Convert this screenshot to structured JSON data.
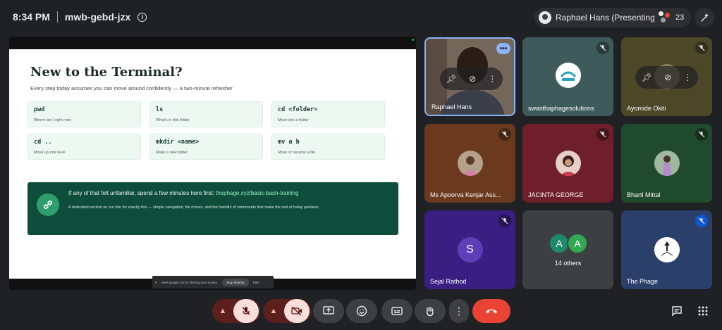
{
  "topbar": {
    "time": "8:34 PM",
    "meeting_code": "mwb-gebd-jzx",
    "presenter_label": "Raphael Hans (Presenting)",
    "people_count": "23"
  },
  "slide": {
    "title": "New to the Terminal?",
    "subtitle": "Every step today assumes you can move around confidently — a two-minute refresher",
    "commands": [
      {
        "cmd": "pwd",
        "desc": "Where am I right now"
      },
      {
        "cmd": "ls",
        "desc": "What's in this folder"
      },
      {
        "cmd": "cd <folder>",
        "desc": "Move into a folder"
      },
      {
        "cmd": "cd ..",
        "desc": "Move up one level"
      },
      {
        "cmd": "mkdir <name>",
        "desc": "Make a new folder"
      },
      {
        "cmd": "mv a b",
        "desc": "Move or rename a file"
      }
    ],
    "banner_title": "If any of that felt unfamiliar, spend a few minutes here first: ",
    "banner_link": "thephage.xyz/basic-bash-training",
    "banner_body": "A dedicated section on our site for exactly this — simple navigation, file moves, and the handful of commands that make the rest of today painless."
  },
  "share_bar": {
    "text": "meet.google.com is sharing your screen.",
    "stop_label": "Stop sharing",
    "hide_label": "Hide"
  },
  "participants": [
    {
      "name": "Raphael Hans",
      "bg": "#6b5a4c"
    },
    {
      "name": "swasthaphagesolutions",
      "bg": "#3f5a5b"
    },
    {
      "name": "Ayomide Okiti",
      "bg": "#4c4727"
    },
    {
      "name": "Ms Apoorva Kenjar Ass...",
      "bg": "#6b3a1e"
    },
    {
      "name": "JACINTA GEORGE",
      "bg": "#6e1f29"
    },
    {
      "name": "Bharti Mittal",
      "bg": "#1f4a2c"
    },
    {
      "name": "Sejal Rathod",
      "bg": "#3a1e82",
      "letter": "S"
    },
    {
      "name": "14 others",
      "bg": "#3c4043",
      "letters": [
        "A",
        "A"
      ]
    },
    {
      "name": "The Phage",
      "bg": "#2b3f6b"
    }
  ],
  "colors": {
    "accent": "#8ab4f8",
    "end_call": "#ea4335",
    "slide_banner": "#0e4d3a"
  }
}
